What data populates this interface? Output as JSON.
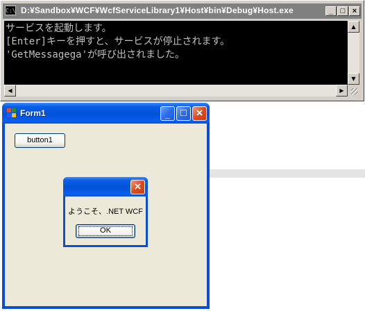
{
  "console": {
    "title": "D:¥Sandbox¥WCF¥WcfServiceLibrary1¥Host¥bin¥Debug¥Host.exe",
    "icon": "cmd-icon",
    "lines": [
      "サービスを起動します。",
      "[Enter]キーを押すと、サービスが停止されます。",
      "'GetMessagega'が呼び出されました。"
    ],
    "buttons": {
      "minimize": "_",
      "maximize": "□",
      "close": "×"
    }
  },
  "form1": {
    "title": "Form1",
    "icon": "winforms-icon",
    "button1_label": "button1",
    "buttons": {
      "minimize": "_",
      "maximize": "□",
      "close": "×"
    }
  },
  "msgbox": {
    "message": "ようこそ、.NET WCF",
    "ok_label": "OK",
    "close": "×"
  },
  "colors": {
    "xp_title": "#0352d8",
    "console_bg": "#000000",
    "console_fg": "#c0c0c0",
    "client_bg": "#ece9d8",
    "close_red": "#e04a1e"
  }
}
